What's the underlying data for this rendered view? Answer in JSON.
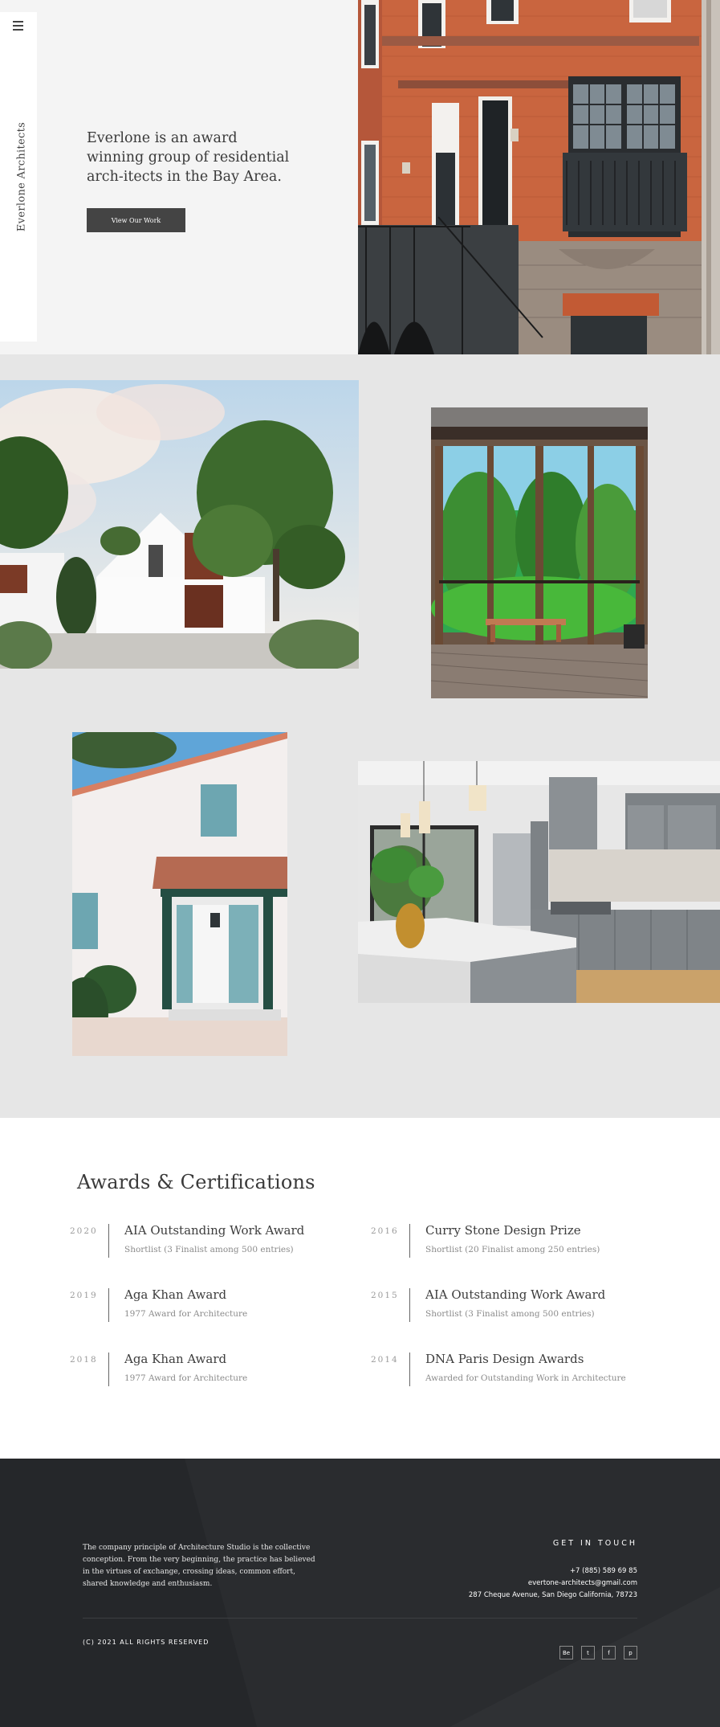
{
  "brand": {
    "name": "Everlone Architects"
  },
  "hero": {
    "tagline": "Everlone is an award winning group of residential arch-itects in the Bay Area.",
    "cta_label": "View Our Work"
  },
  "awards": {
    "title": "Awards & Certifications",
    "items": [
      {
        "year": "2020",
        "name": "AIA Outstanding Work Award",
        "desc": "Shortlist (3 Finalist among 500 entries)"
      },
      {
        "year": "2016",
        "name": "Curry Stone Design Prize",
        "desc": "Shortlist (20 Finalist among 250 entries)"
      },
      {
        "year": "2019",
        "name": "Aga Khan Award",
        "desc": "1977 Award for Architecture"
      },
      {
        "year": "2015",
        "name": "AIA Outstanding Work Award",
        "desc": "Shortlist (3 Finalist among 500 entries)"
      },
      {
        "year": "2018",
        "name": "Aga Khan Award",
        "desc": "1977 Award for Architecture"
      },
      {
        "year": "2014",
        "name": "DNA Paris Design Awards",
        "desc": "Awarded for Outstanding Work in Architecture"
      }
    ]
  },
  "footer": {
    "about": "The company principle of Architecture Studio is the collective conception. From the very beginning, the practice has believed in the virtues of exchange, crossing ideas, common effort, shared knowledge and enthusiasm.",
    "get_in_touch": "GET IN TOUCH",
    "phone": "+7 (885) 589 69 85",
    "email": "evertone-architects@gmail.com",
    "address": "287 Cheque Avenue, San Diego California, 78723",
    "copyright": "(C) 2021 ALL RIGHTS RESERVED",
    "social": [
      {
        "icon": "behance-icon",
        "label": "Be"
      },
      {
        "icon": "twitter-icon",
        "label": "t"
      },
      {
        "icon": "facebook-icon",
        "label": "f"
      },
      {
        "icon": "pinterest-icon",
        "label": "p"
      }
    ]
  },
  "colors": {
    "dark_button": "#444444",
    "gallery_bg": "#e6e6e6",
    "footer_bg": "#25272a"
  }
}
